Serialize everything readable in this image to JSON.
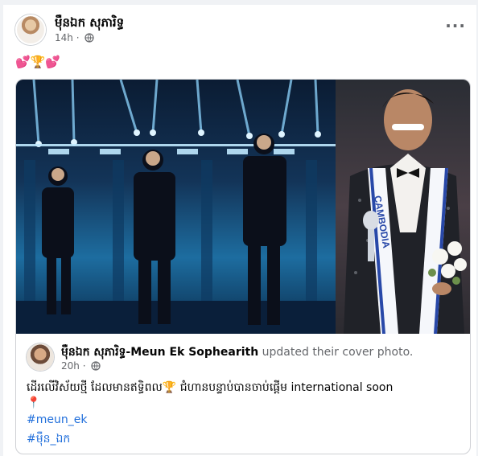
{
  "post": {
    "author": "ម៉ឺនឯក សុភារិទ្ធ",
    "time": "14h",
    "text": "💕🏆💕"
  },
  "shared": {
    "author": "ម៉ឺនឯក សុភារិទ្ធ-Meun Ek Sophearith",
    "action": "updated their cover photo.",
    "time": "20h",
    "caption": "ដើរលើវិស័យថ្មី ដែលមានឥទ្ធិពល🏆 ជំហានបន្ទាប់បានចាប់ផ្ដើម  international soon",
    "pin": "📍",
    "hashtags": [
      "#meun_ek",
      "#ម៉ឺន_ឯក"
    ]
  },
  "photo": {
    "sash_text": "CAMBODIA"
  },
  "icons": {
    "globe": "globe-icon",
    "more": "more-options-icon"
  }
}
